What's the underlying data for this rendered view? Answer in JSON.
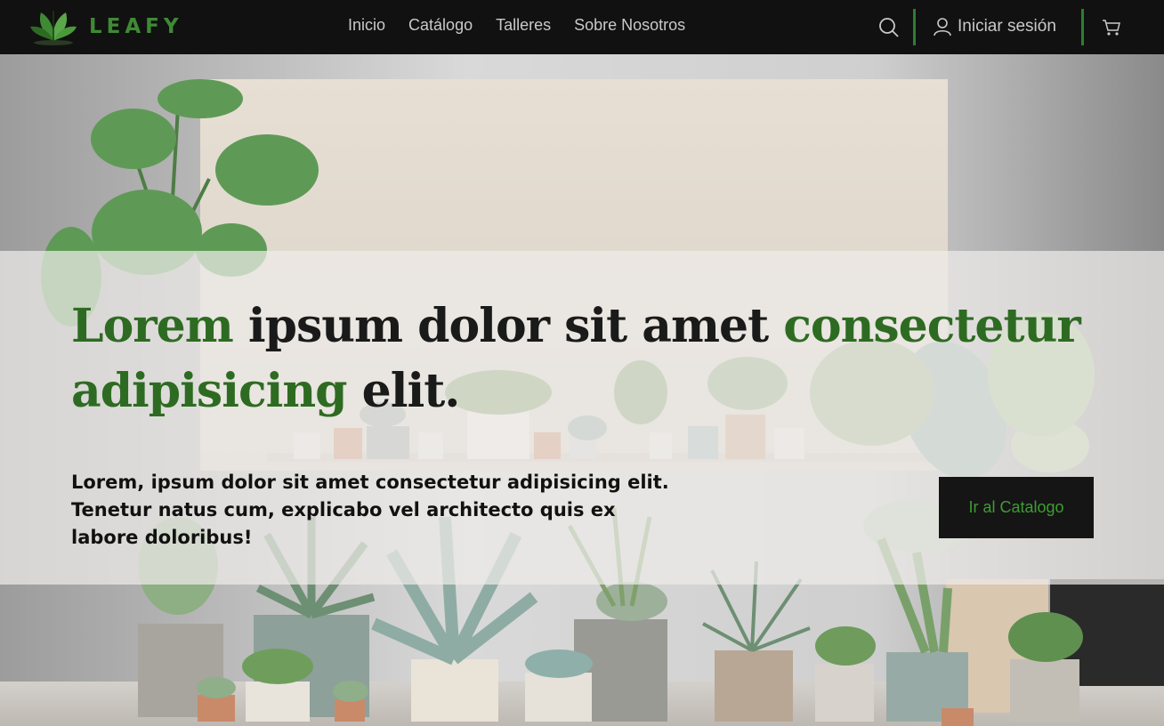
{
  "brand": {
    "name": "LEAFY",
    "logo_icon": "leaf-logo-icon"
  },
  "nav": {
    "links": [
      "Inicio",
      "Catálogo",
      "Talleres",
      "Sobre Nosotros"
    ],
    "search_icon": "search-icon",
    "login_label": "Iniciar sesión",
    "user_icon": "user-icon",
    "cart_icon": "cart-icon"
  },
  "hero": {
    "title_part1": "Lorem",
    "title_part2": " ipsum dolor sit amet ",
    "title_part3": "consectetur adipisicing",
    "title_part4": " elit.",
    "subtitle": "Lorem, ipsum dolor sit amet consectetur adipisicing elit. Tenetur natus cum, explicabo vel architecto quis ex labore doloribus!",
    "cta_label": "Ir al Catalogo"
  },
  "colors": {
    "nav_bg": "#111111",
    "accent": "#2e7d32",
    "title_green": "#2e6b22",
    "cta_bg": "#151515"
  }
}
